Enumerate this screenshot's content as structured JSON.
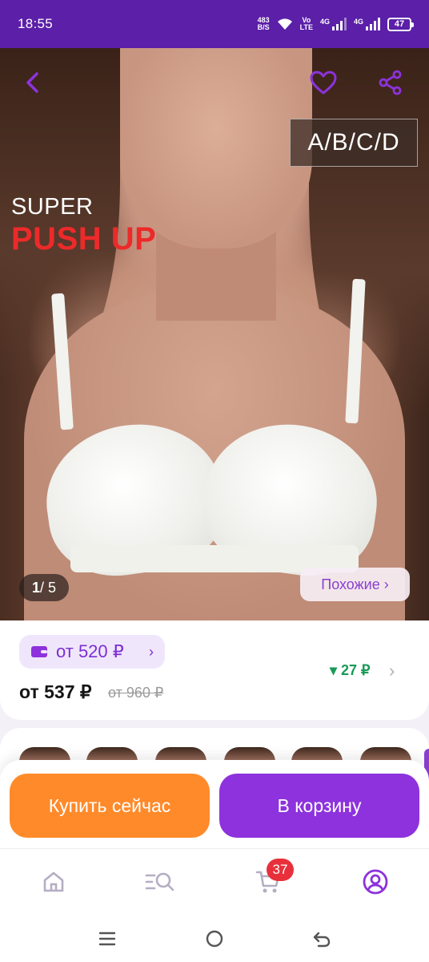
{
  "status_bar": {
    "time": "18:55",
    "net_speed_value": "483",
    "net_speed_unit": "B/S",
    "volte_top": "Vo",
    "volte_bottom": "LTE",
    "signal1_label": "4G",
    "signal2_label": "4G",
    "battery": "47"
  },
  "hero": {
    "size_badge": "A/B/C/D",
    "promo_line1": "SUPER",
    "promo_line2": "PUSH UP",
    "page_current": "1",
    "page_total": "/ 5",
    "similar_label": "Похожие ›"
  },
  "price": {
    "wallet_price": "от 520 ₽",
    "wallet_chevron": "›",
    "price_main": "от 537 ₽",
    "price_old": "от 960 ₽",
    "delta": "▾ 27 ₽",
    "delta_chevron": "›"
  },
  "actions": {
    "buy_now": "Купить сейчас",
    "to_cart": "В корзину"
  },
  "bottom_nav": {
    "cart_count": "37"
  },
  "colors": {
    "status_bar": "#5b1fa8",
    "accent_purple": "#8d32dc",
    "accent_orange": "#ff8a2a",
    "badge_red": "#e8303b",
    "delta_green": "#1a9a58",
    "promo_red": "#ec2a2a"
  },
  "icons": {
    "back": "chevron-left-icon",
    "favorite": "heart-icon",
    "share": "share-icon",
    "wallet": "wallet-icon",
    "home": "home-icon",
    "catalog": "catalog-search-icon",
    "cart": "cart-icon",
    "profile": "profile-icon"
  }
}
